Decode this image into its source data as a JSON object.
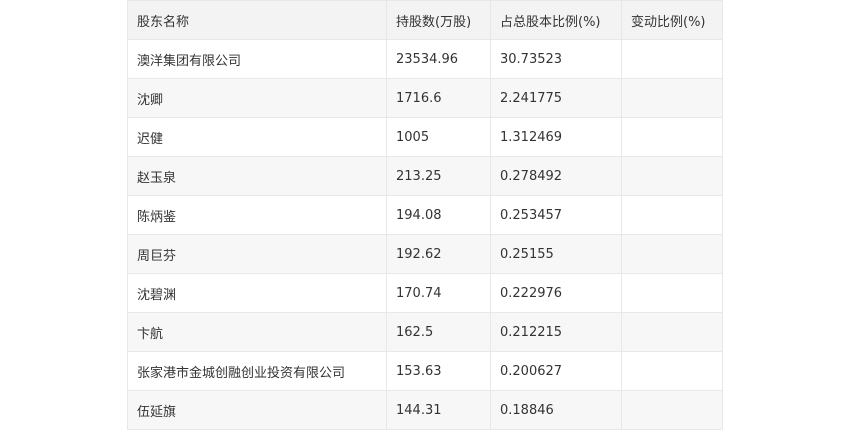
{
  "table": {
    "headers": [
      "股东名称",
      "持股数(万股)",
      "占总股本比例(%)",
      "变动比例(%)"
    ],
    "rows": [
      [
        "澳洋集团有限公司",
        "23534.96",
        "30.73523",
        ""
      ],
      [
        "沈卿",
        "1716.6",
        "2.241775",
        ""
      ],
      [
        "迟健",
        "1005",
        "1.312469",
        ""
      ],
      [
        "赵玉泉",
        "213.25",
        "0.278492",
        ""
      ],
      [
        "陈炳鉴",
        "194.08",
        "0.253457",
        ""
      ],
      [
        "周巨芬",
        "192.62",
        "0.25155",
        ""
      ],
      [
        "沈碧渊",
        "170.74",
        "0.222976",
        ""
      ],
      [
        "卞航",
        "162.5",
        "0.212215",
        ""
      ],
      [
        "张家港市金城创融创业投资有限公司",
        "153.63",
        "0.200627",
        ""
      ],
      [
        "伍延旗",
        "144.31",
        "0.18846",
        ""
      ]
    ]
  }
}
